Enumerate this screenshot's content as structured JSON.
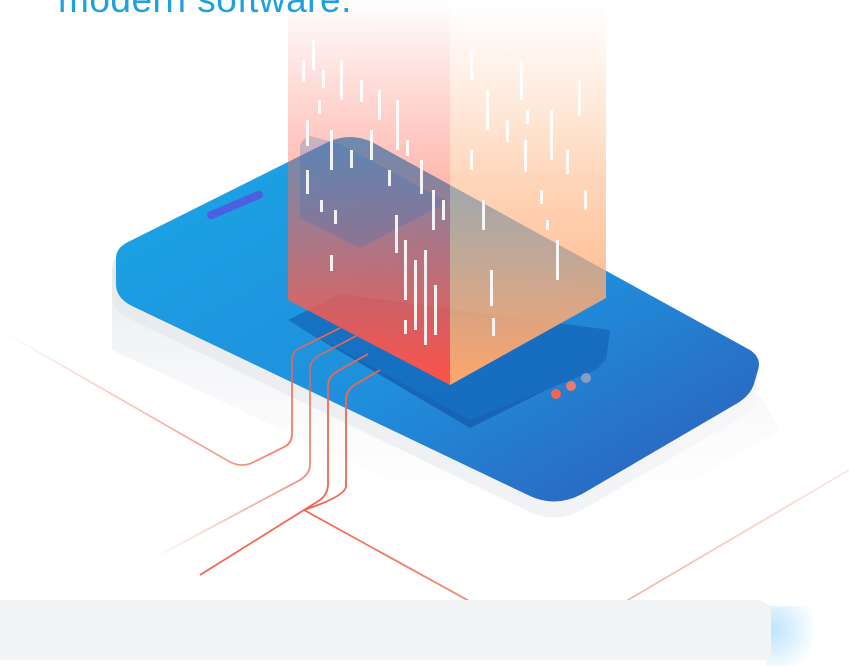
{
  "headline": {
    "text": "modern software.",
    "color": "#1fa1e0"
  },
  "illustration": {
    "icons": [
      "smartphone-icon",
      "data-tower-icon",
      "circuit-line-icon",
      "dots-indicator-icon"
    ],
    "colors": {
      "phone_blue": "#1f8fdc",
      "phone_blue_dark": "#2f5bb8",
      "tower_red": "#ff5a4a",
      "tower_orange": "#ffad6e",
      "circuit_line": "#f2664f",
      "dot_orange": "#f2664f",
      "dot_grey": "#8a9bc4",
      "base_shadow": "#eef0f3"
    }
  },
  "footer_card": {
    "color": "#f3f4f5"
  }
}
